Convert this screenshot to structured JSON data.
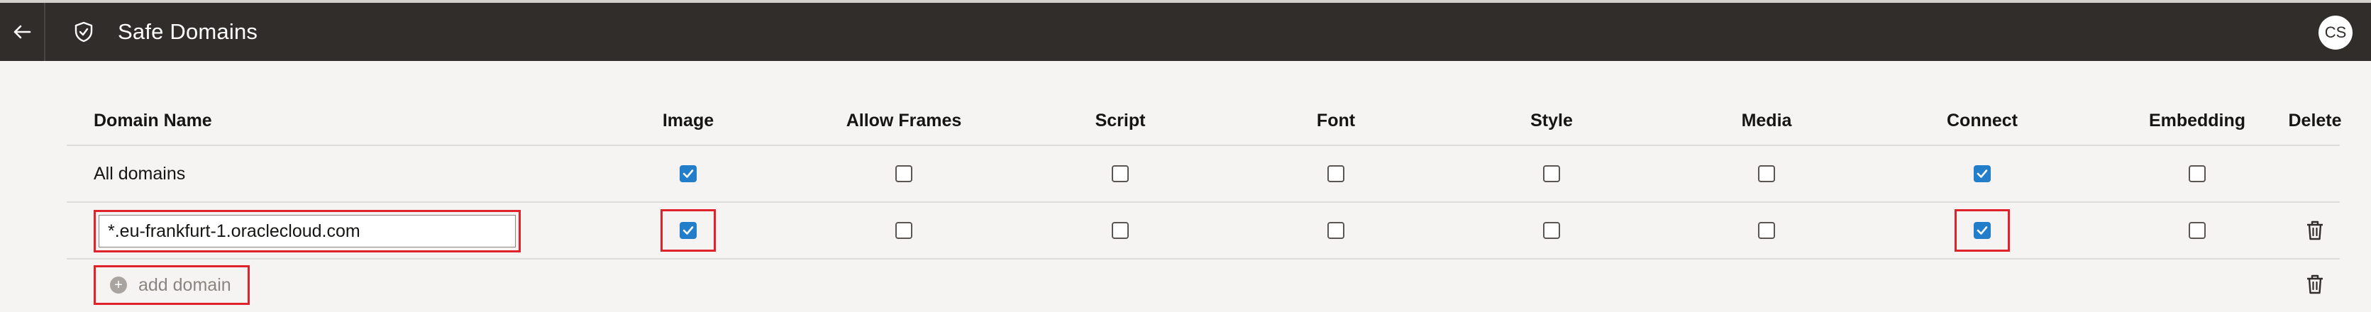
{
  "header": {
    "title": "Safe Domains",
    "avatar_initials": "CS"
  },
  "table": {
    "columns": [
      "Domain Name",
      "Image",
      "Allow Frames",
      "Script",
      "Font",
      "Style",
      "Media",
      "Connect",
      "Embedding",
      "Delete"
    ],
    "rows": [
      {
        "domain": "All domains",
        "editable": false,
        "permissions": {
          "image": true,
          "allow_frames": false,
          "script": false,
          "font": false,
          "style": false,
          "media": false,
          "connect": true,
          "embedding": false
        }
      },
      {
        "domain": "*.eu-frankfurt-1.oraclecloud.com",
        "editable": true,
        "permissions": {
          "image": true,
          "allow_frames": false,
          "script": false,
          "font": false,
          "style": false,
          "media": false,
          "connect": true,
          "embedding": false
        }
      }
    ],
    "add_domain_label": "add domain"
  },
  "colors": {
    "header_bg": "#312d2a",
    "checkbox_checked": "#227ecb",
    "highlight": "#e0232b"
  }
}
